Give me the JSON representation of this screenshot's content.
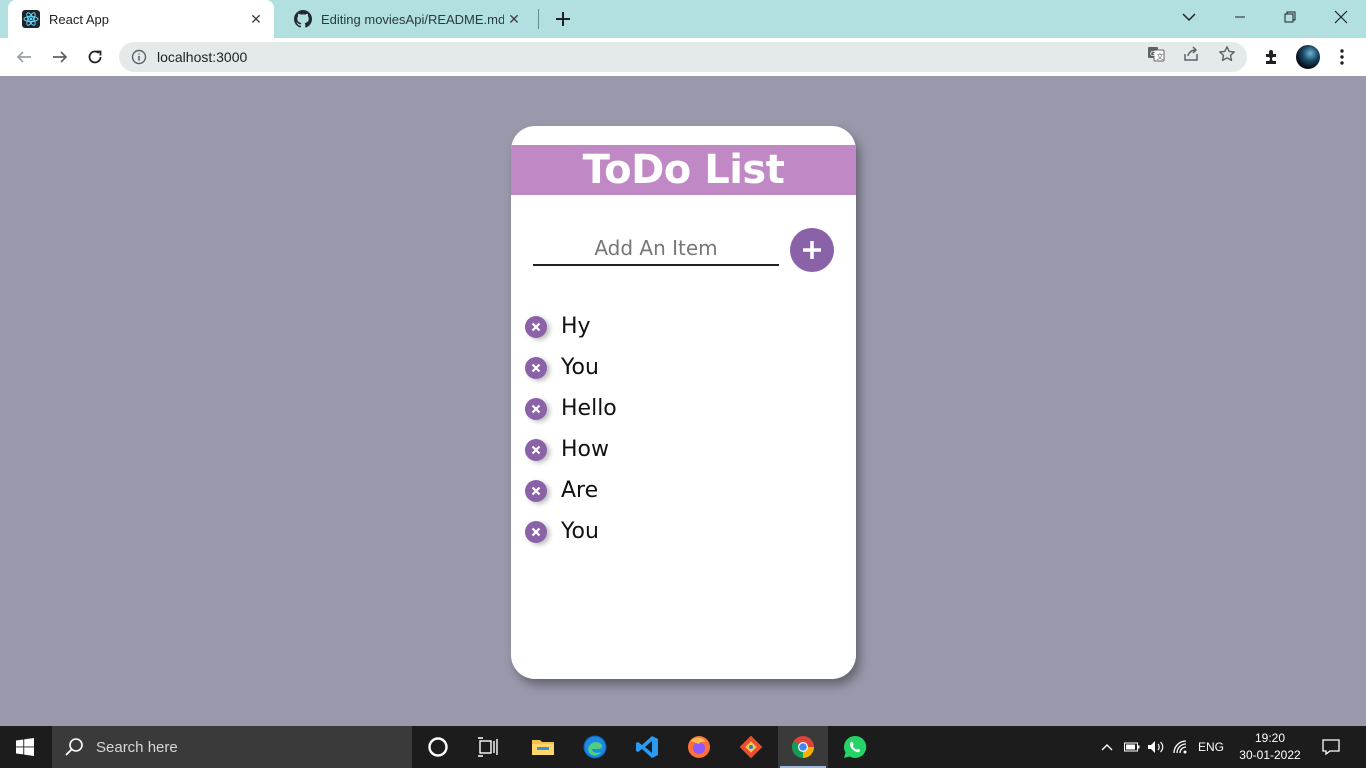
{
  "browser": {
    "tabs": [
      {
        "title": "React App",
        "icon": "react-icon",
        "active": true
      },
      {
        "title": "Editing moviesApi/README.md a",
        "icon": "github-icon",
        "active": false
      }
    ],
    "url": "localhost:3000"
  },
  "app": {
    "title": "ToDo List",
    "input_placeholder": "Add An Item",
    "add_button_icon": "plus-icon",
    "items": [
      "Hy",
      "You",
      "Hello",
      "How",
      "Are",
      "You"
    ],
    "accent_color": "#8a62a8",
    "header_color": "#c088c4",
    "background_color": "#9a99ac"
  },
  "taskbar": {
    "search_placeholder": "Search here",
    "apps": [
      "cortana-icon",
      "task-view-icon",
      "file-explorer-icon",
      "edge-icon",
      "vscode-icon",
      "firefox-icon",
      "git-icon",
      "chrome-icon",
      "whatsapp-icon"
    ],
    "language": "ENG",
    "time": "19:20",
    "date": "30-01-2022"
  }
}
